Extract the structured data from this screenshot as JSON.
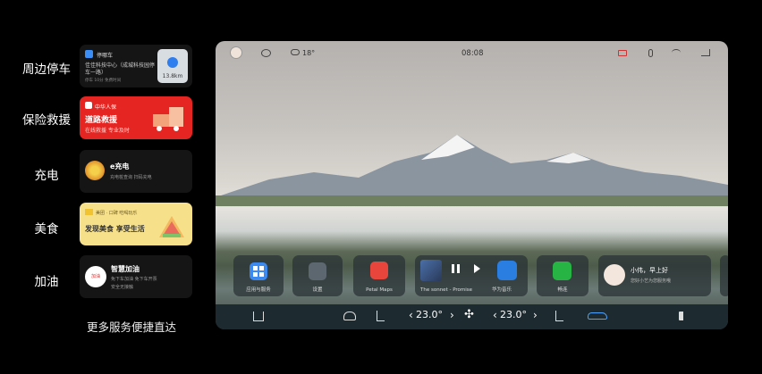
{
  "services": [
    {
      "label": "周边停车"
    },
    {
      "label": "保险救援"
    },
    {
      "label": "充电"
    },
    {
      "label": "美食"
    },
    {
      "label": "加油"
    }
  ],
  "more_text": "更多服务便捷直达",
  "cards": {
    "parking": {
      "app": "停哪车",
      "place": "佳佳科技中心（成城科技园停车一路）",
      "sub": "停车 10分  免费时间",
      "distance": "13.8km"
    },
    "rescue": {
      "brand": "中华人保",
      "title": "道路救援",
      "sub": "在线救援 专业及时"
    },
    "charging": {
      "title": "e充电",
      "sub": "充电桩查询  扫码充电"
    },
    "food": {
      "brand": "美团 · 口碑  吃喝玩乐",
      "title": "发现美食 享受生活"
    },
    "fuel": {
      "title": "智慧加油",
      "sub1": "免下车加油 免下车开票",
      "sub2": "安全无接触",
      "logo": "加油"
    }
  },
  "status_bar": {
    "temperature": "18°",
    "time": "08:08"
  },
  "dock": {
    "apps_label": "应用与服务",
    "settings_label": "设置",
    "maps_label": "Petal Maps",
    "song": "The sonnet - Promise",
    "music_label": "华为音乐",
    "message_label": "畅连",
    "greeting": "小伟，早上好",
    "greeting_sub": "您好小艺为您服务哦"
  },
  "climate": {
    "left_temp": "23.0°",
    "right_temp": "23.0°"
  },
  "colors": {
    "rescue_red": "#e52521",
    "food_yellow": "#f6e08a",
    "maps_red": "#e8453c",
    "music_blue": "#2a7de1",
    "message_green": "#27b445"
  }
}
